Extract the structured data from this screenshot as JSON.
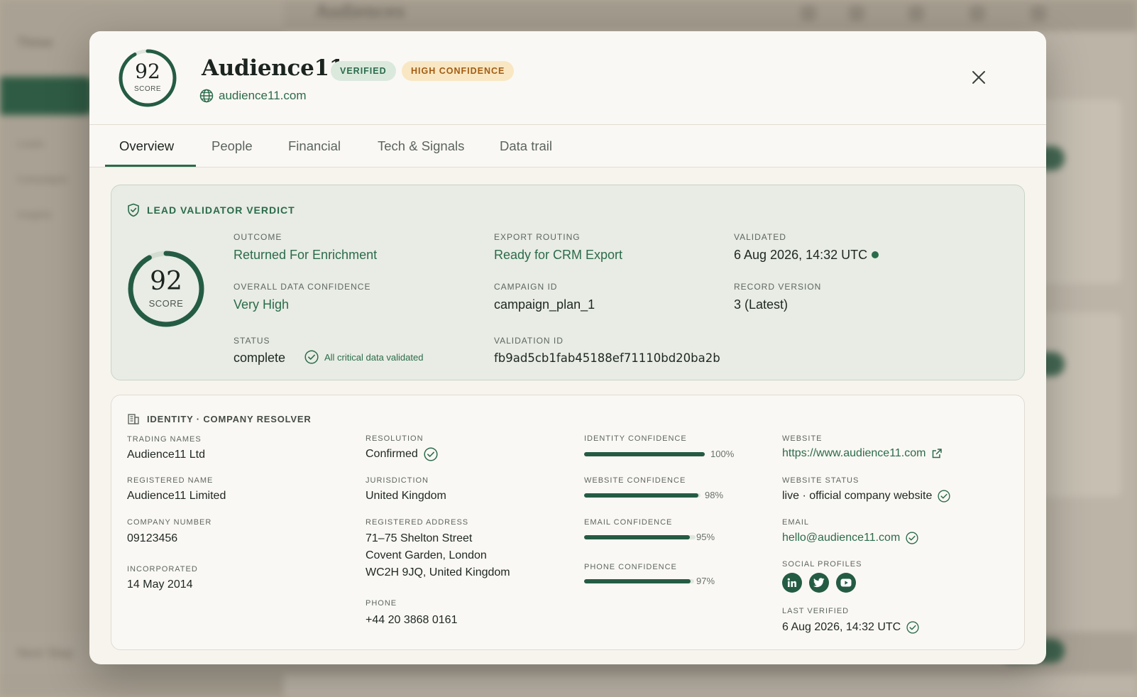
{
  "background": {
    "title": "Audiences",
    "brand": "Thrive",
    "nav": [
      "Leads",
      "Campaigns",
      "Insights"
    ],
    "bottom_text": "Next Step"
  },
  "header": {
    "score": "92",
    "score_label": "SCORE",
    "company_name": "Audience11",
    "badges": {
      "verified": "VERIFIED",
      "confidence": "HIGH CONFIDENCE"
    },
    "domain": "audience11.com"
  },
  "tabs": [
    {
      "label": "Overview",
      "active": true
    },
    {
      "label": "People"
    },
    {
      "label": "Financial"
    },
    {
      "label": "Tech & Signals"
    },
    {
      "label": "Data trail"
    }
  ],
  "verdict": {
    "title": "LEAD VALIDATOR VERDICT",
    "score": "92",
    "score_label": "SCORE",
    "score_fraction": 0.92,
    "outcome_label": "OUTCOME",
    "outcome": "Returned For Enrichment",
    "confidence_label": "OVERALL DATA CONFIDENCE",
    "confidence": "Very High",
    "status_label": "STATUS",
    "status": "complete",
    "status_note": "All critical data validated",
    "export_label": "EXPORT ROUTING",
    "export": "Ready for CRM Export",
    "campaign_label": "CAMPAIGN ID",
    "campaign": "campaign_plan_1",
    "validation_label": "VALIDATION ID",
    "validation_id": "fb9ad5cb1fab45188ef71110bd20ba2b",
    "validated_label": "VALIDATED",
    "validated": "6 Aug 2026, 14:32 UTC",
    "version_label": "RECORD VERSION",
    "version": "3 (Latest)"
  },
  "identity": {
    "title": "IDENTITY · COMPANY RESOLVER",
    "trading_names_label": "TRADING NAMES",
    "trading_names": "Audience11 Ltd",
    "registered_name_label": "REGISTERED NAME",
    "registered_name": "Audience11 Limited",
    "company_number_label": "COMPANY NUMBER",
    "company_number": "09123456",
    "incorporated_label": "INCORPORATED",
    "incorporated": "14 May 2014",
    "resolution_label": "RESOLUTION",
    "resolution": "Confirmed",
    "jurisdiction_label": "JURISDICTION",
    "jurisdiction": "United Kingdom",
    "address_label": "REGISTERED ADDRESS",
    "address_line1": "71–75 Shelton Street",
    "address_line2": "Covent Garden, London",
    "address_line3": "WC2H 9JQ, United Kingdom",
    "phone_label": "PHONE",
    "phone": "+44 20 3868 0161",
    "confidences": [
      {
        "label": "IDENTITY CONFIDENCE",
        "value": 100,
        "text": "100%"
      },
      {
        "label": "WEBSITE CONFIDENCE",
        "value": 98,
        "text": "98%"
      },
      {
        "label": "EMAIL CONFIDENCE",
        "value": 95,
        "text": "95%"
      },
      {
        "label": "PHONE CONFIDENCE",
        "value": 97,
        "text": "97%"
      }
    ],
    "website_label": "WEBSITE",
    "website": "https://www.audience11.com",
    "website_status_label": "WEBSITE STATUS",
    "website_status": "live · official company website",
    "email_label": "EMAIL",
    "email": "hello@audience11.com",
    "social_label": "SOCIAL PROFILES",
    "social": [
      "linkedin-icon",
      "twitter-icon",
      "youtube-icon"
    ],
    "last_verified_label": "LAST VERIFIED",
    "last_verified": "6 Aug 2026, 14:32 UTC"
  },
  "colors": {
    "accent": "#2b6b4a",
    "badge_high_bg": "#f8e7c2",
    "badge_verified_bg": "#dbe9dd"
  }
}
